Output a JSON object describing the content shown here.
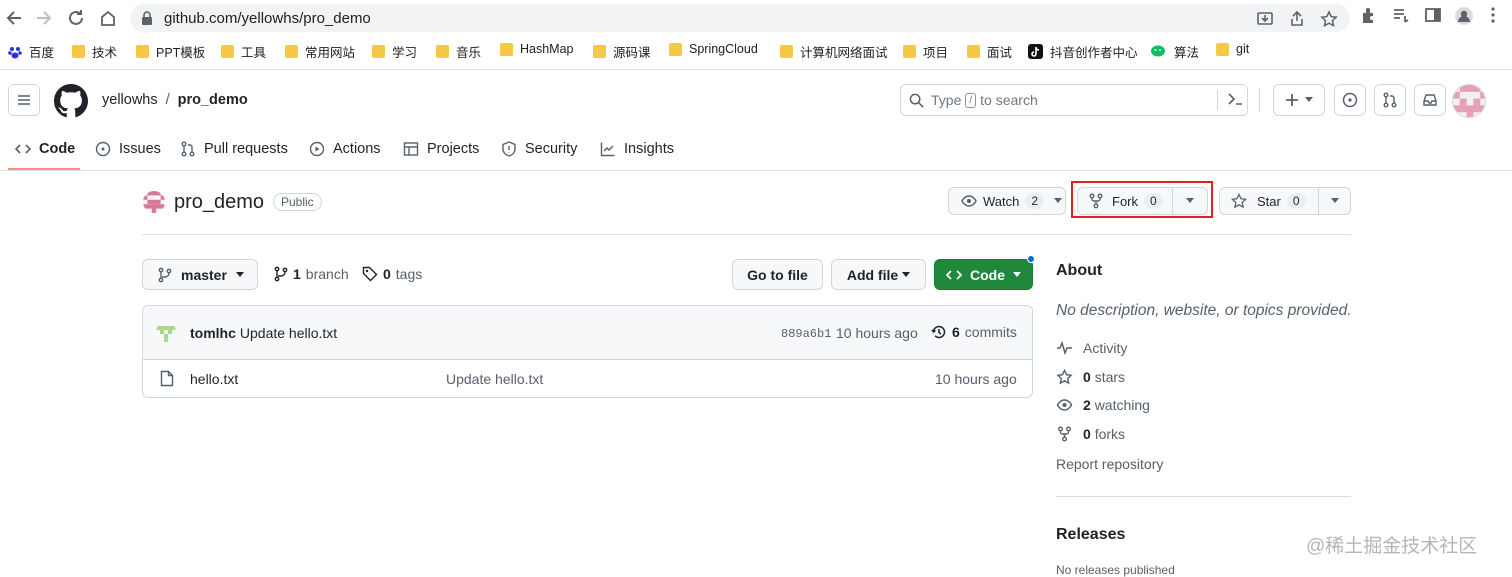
{
  "browser": {
    "url": "github.com/yellowhs/pro_demo",
    "bookmarks": [
      "百度",
      "技术",
      "PPT模板",
      "工具",
      "常用网站",
      "学习",
      "音乐",
      "HashMap",
      "源码课",
      "SpringCloud",
      "计算机网络面试",
      "项目",
      "面试",
      "抖音创作者中心",
      "算法",
      "git"
    ]
  },
  "header": {
    "owner": "yellowhs",
    "separator": "/",
    "repo": "pro_demo",
    "search_pre": "Type",
    "search_key": "/",
    "search_post": "to search"
  },
  "tabs": [
    "Code",
    "Issues",
    "Pull requests",
    "Actions",
    "Projects",
    "Security",
    "Insights"
  ],
  "repo": {
    "name": "pro_demo",
    "visibility": "Public",
    "watch_label": "Watch",
    "watch_count": "2",
    "fork_label": "Fork",
    "fork_count": "0",
    "star_label": "Star",
    "star_count": "0"
  },
  "toolbar": {
    "branch": "master",
    "branch_count": "1",
    "branch_word": "branch",
    "tag_count": "0",
    "tag_word": "tags",
    "go_to_file": "Go to file",
    "add_file": "Add file",
    "code": "Code"
  },
  "commit": {
    "author": "tomlhc",
    "message": "Update hello.txt",
    "sha": "889a6b1",
    "time": "10 hours ago",
    "count": "6",
    "count_word": "commits"
  },
  "files": [
    {
      "name": "hello.txt",
      "message": "Update hello.txt",
      "time": "10 hours ago"
    }
  ],
  "about": {
    "title": "About",
    "description": "No description, website, or topics provided.",
    "activity": "Activity",
    "stars_n": "0",
    "stars_w": "stars",
    "watching_n": "2",
    "watching_w": "watching",
    "forks_n": "0",
    "forks_w": "forks",
    "report": "Report repository",
    "releases": "Releases",
    "releases_sub": "No releases published"
  },
  "watermark": "@稀土掘金技术社区",
  "colors": {
    "accent": "#fd8c73",
    "green": "#1f883d",
    "highlight": "#e02020"
  }
}
